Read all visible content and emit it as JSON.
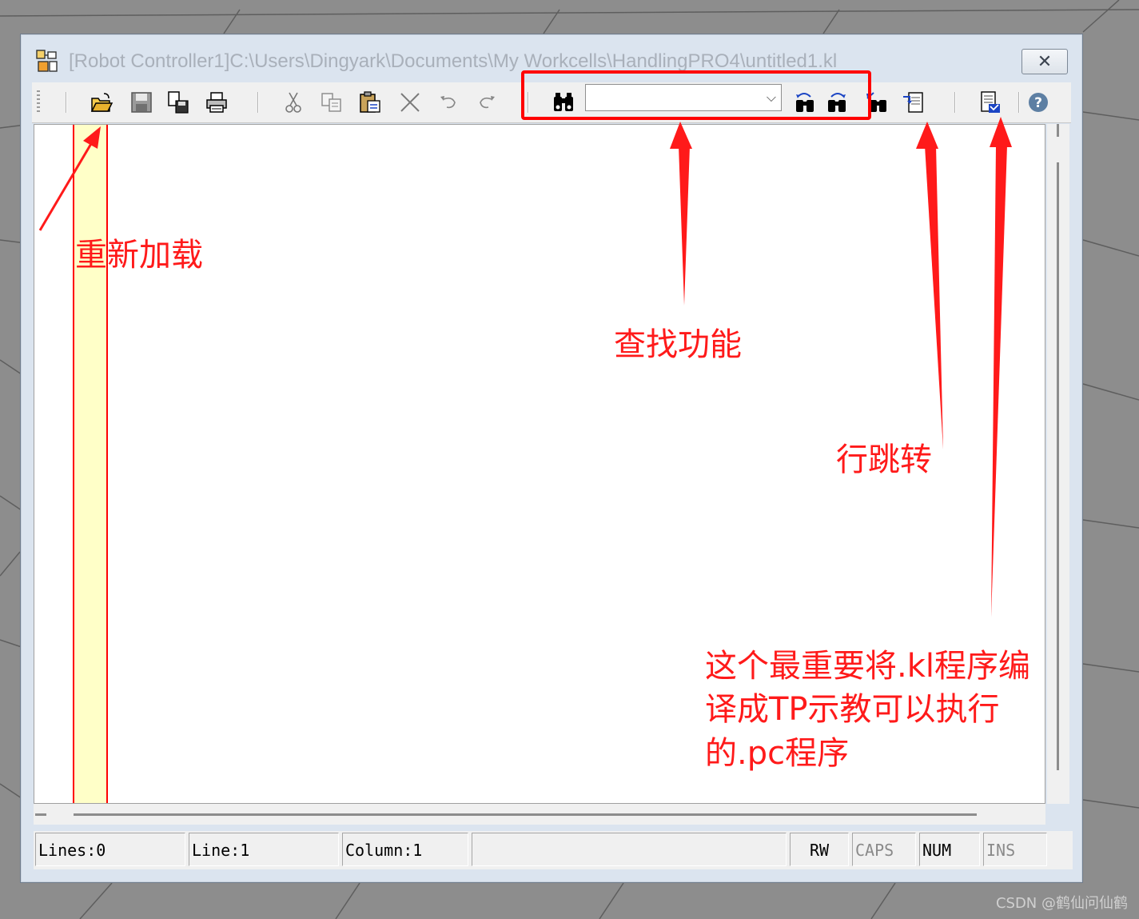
{
  "window": {
    "title": "[Robot Controller1]C:\\Users\\Dingyark\\Documents\\My Workcells\\HandlingPRO4\\untitled1.kl",
    "close_glyph": "✕"
  },
  "toolbar": {
    "icons": [
      "open-file-icon",
      "save-icon",
      "save-all-icon",
      "print-icon",
      "cut-icon",
      "copy-icon",
      "paste-icon",
      "delete-icon",
      "undo-icon",
      "redo-icon",
      "find-icon",
      "find-prev-icon",
      "find-next-icon",
      "replace-icon",
      "goto-line-icon",
      "compile-icon",
      "help-icon"
    ],
    "find_value": "",
    "find_dropdown_glyph": "⌵"
  },
  "statusbar": {
    "lines": "Lines:0",
    "line": "Line:1",
    "column": "Column:1",
    "message": "",
    "rw": "RW",
    "caps": "CAPS",
    "num": "NUM",
    "ins": "INS"
  },
  "annotations": {
    "reload": "重新加载",
    "find": "查找功能",
    "goto_line": "行跳转",
    "compile_line1": "这个最重要将.kl程序编",
    "compile_line2": "译成TP示教可以执行",
    "compile_line3": "的.pc程序"
  },
  "watermark": "CSDN @鹤仙问仙鹤",
  "colors": {
    "annotation": "#ff1a1a",
    "gutter": "#ffffc8",
    "window_frame": "#dbe4ef",
    "toolbar": "#f0f0f0"
  }
}
